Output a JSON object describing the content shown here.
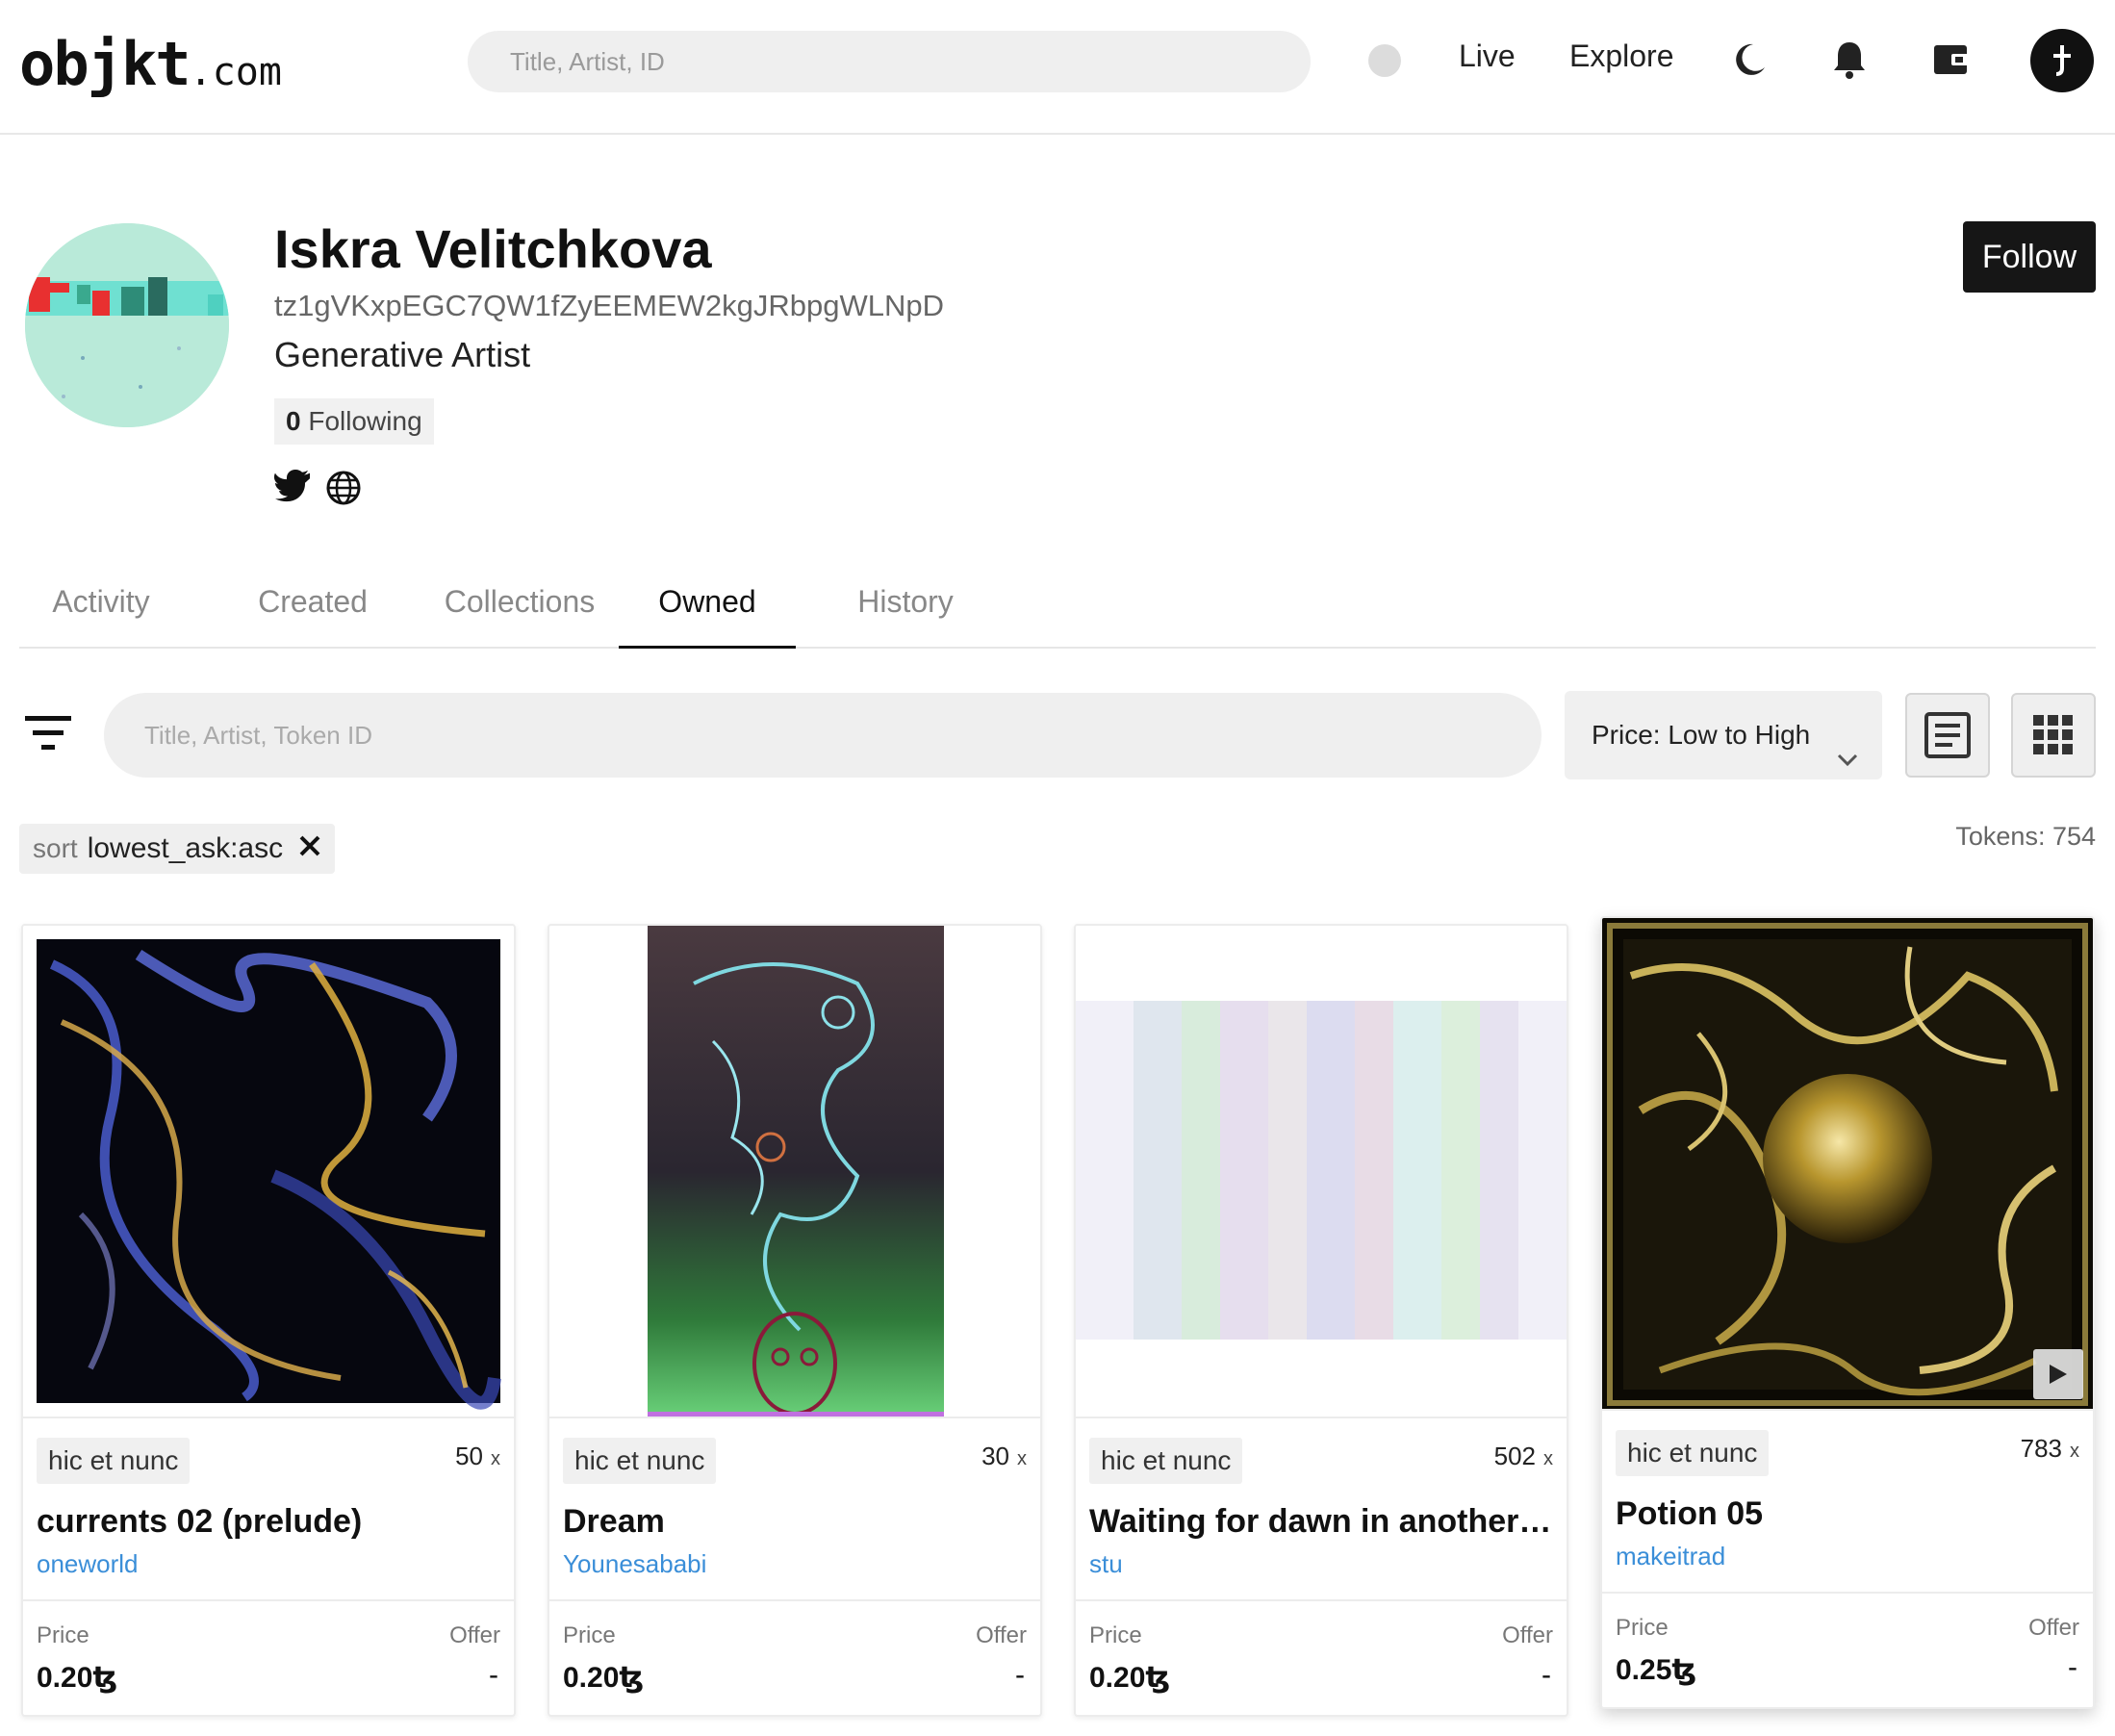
{
  "nav": {
    "logo_main": "objkt",
    "logo_suffix": ".com",
    "search_placeholder": "Title, Artist, ID",
    "live": "Live",
    "explore": "Explore",
    "icons": [
      "moon-icon",
      "bell-icon",
      "wallet-icon",
      "user-avatar"
    ]
  },
  "profile": {
    "name": "Iskra Velitchkova",
    "address": "tz1gVKxpEGC7QW1fZyEEMEW2kgJRbpgWLNpD",
    "bio": "Generative Artist",
    "following_count": "0",
    "following_label": "Following",
    "follow_button": "Follow",
    "social_icons": [
      "twitter-icon",
      "globe-icon"
    ]
  },
  "tabs": [
    {
      "label": "Activity",
      "active": false
    },
    {
      "label": "Created",
      "active": false
    },
    {
      "label": "Collections",
      "active": false
    },
    {
      "label": "Owned",
      "active": true
    },
    {
      "label": "History",
      "active": false
    }
  ],
  "filters": {
    "search_placeholder": "Title, Artist, Token ID",
    "sort_selected": "Price: Low to High",
    "active_sort_key": "sort",
    "active_sort_value": "lowest_ask:asc",
    "tokens_count": "Tokens: 754"
  },
  "cards": [
    {
      "platform": "hic et nunc",
      "editions": "50",
      "editions_suffix": "x",
      "title": "currents 02 (prelude)",
      "artist": "oneworld",
      "price_label": "Price",
      "offer_label": "Offer",
      "price": "0.20ꜩ",
      "offer": "-"
    },
    {
      "platform": "hic et nunc",
      "editions": "30",
      "editions_suffix": "x",
      "title": "Dream",
      "artist": "Younesababi",
      "price_label": "Price",
      "offer_label": "Offer",
      "price": "0.20ꜩ",
      "offer": "-"
    },
    {
      "platform": "hic et nunc",
      "editions": "502",
      "editions_suffix": "x",
      "title": "Waiting for dawn in another…",
      "artist": "stu",
      "price_label": "Price",
      "offer_label": "Offer",
      "price": "0.20ꜩ",
      "offer": "-"
    },
    {
      "platform": "hic et nunc",
      "editions": "783",
      "editions_suffix": "x",
      "title": "Potion 05",
      "artist": "makeitrad",
      "price_label": "Price",
      "offer_label": "Offer",
      "price": "0.25ꜩ",
      "offer": "-"
    }
  ],
  "colors": {
    "accent_link": "#3a8ed8",
    "follow_bg": "#161616",
    "chip_bg": "#f0f0f0"
  }
}
